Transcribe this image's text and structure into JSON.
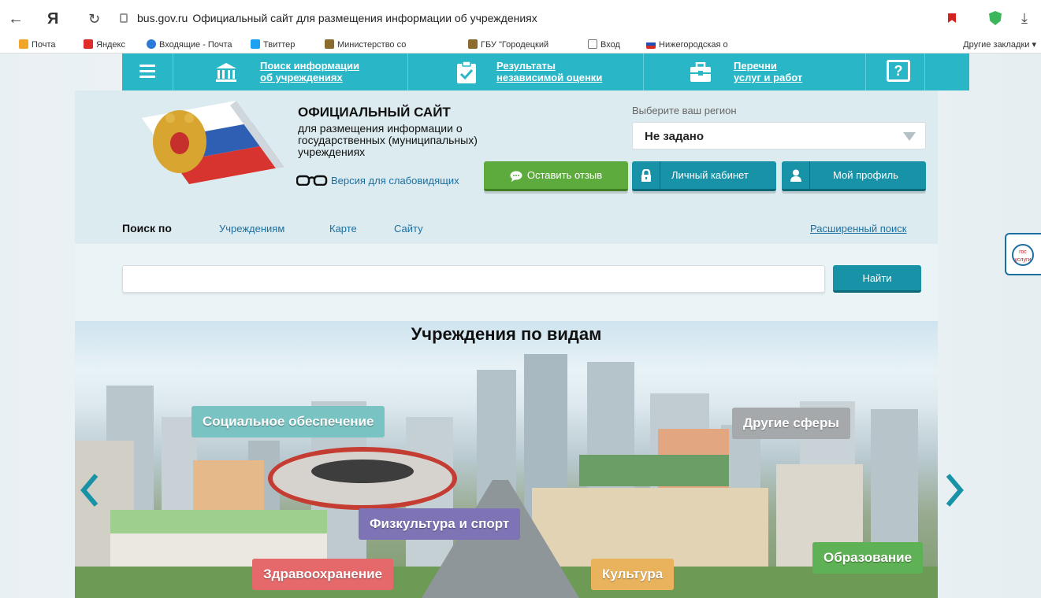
{
  "browser": {
    "host": "bus.gov.ru",
    "title": "Официальный сайт для размещения информации об учреждениях",
    "bookmarks": [
      {
        "label": "Почта",
        "color": "#f2a52b"
      },
      {
        "label": "Яндекс",
        "color": "#e02b2b"
      },
      {
        "label": "Входящие - Почта",
        "color": "#2a7ad6"
      },
      {
        "label": "Твиттер",
        "color": "#1da1f2"
      },
      {
        "label": "Министерство со",
        "color": "#8a6a2e"
      },
      {
        "label": "ГБУ \"Городецкий",
        "color": "#8a6a2e"
      },
      {
        "label": "Вход",
        "color": "#777777"
      },
      {
        "label": "Нижегородская о",
        "color": "#1f4fb4"
      }
    ],
    "other_bookmarks": "Другие закладки ▾"
  },
  "topnav": {
    "items": [
      {
        "line1": "Поиск информации",
        "line2": "об учреждениях",
        "icon": "institution-icon"
      },
      {
        "line1": "Результаты",
        "line2": "независимой оценки",
        "icon": "checklist-icon"
      },
      {
        "line1": "Перечни",
        "line2": "услуг и работ",
        "icon": "briefcase-icon"
      }
    ]
  },
  "header": {
    "site_title": "ОФИЦИАЛЬНЫЙ САЙТ",
    "site_subtitle": "для размещения информации о государственных (муниципальных) учреждениях",
    "low_vision": "Версия для слабовидящих",
    "region_label": "Выберите ваш регион",
    "region_value": "Не задано",
    "buttons": {
      "feedback": "Оставить отзыв",
      "cabinet": "Личный кабинет",
      "profile": "Мой профиль"
    }
  },
  "search": {
    "label": "Поиск по",
    "tabs": [
      "Учреждениям",
      "Карте",
      "Сайту"
    ],
    "advanced": "Расширенный поиск",
    "button": "Найти",
    "value": "",
    "placeholder": ""
  },
  "gosuslugi": {
    "logo_text": "гос услуги"
  },
  "carousel": {
    "title": "Учреждения по видам",
    "categories": [
      {
        "label": "Социальное обеспечение",
        "color": "#79c3c3"
      },
      {
        "label": "Другие сферы",
        "color": "#a5a9ab"
      },
      {
        "label": "Физкультура и спорт",
        "color": "#7e73b5"
      },
      {
        "label": "Здравоохранение",
        "color": "#e5686b"
      },
      {
        "label": "Культура",
        "color": "#e9b25d"
      },
      {
        "label": "Образование",
        "color": "#5eb154"
      }
    ]
  },
  "colors": {
    "accent": "#29b7c8",
    "button_teal": "#1792a6",
    "button_green": "#5dab3d",
    "link": "#1b6fa0"
  }
}
